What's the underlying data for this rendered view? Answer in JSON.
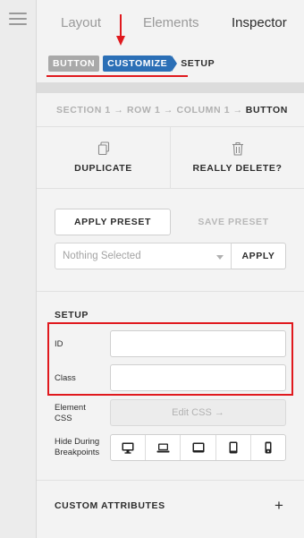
{
  "tabs": [
    "Layout",
    "Elements",
    "Inspector"
  ],
  "breadcrumb": {
    "item1": "BUTTON",
    "item2": "CUSTOMIZE",
    "item3": "SETUP"
  },
  "path": {
    "prefix": "SECTION 1 → ROW 1 → COLUMN 1 →",
    "last": "BUTTON"
  },
  "actions": {
    "duplicate": "DUPLICATE",
    "delete": "REALLY DELETE?"
  },
  "preset": {
    "apply_preset": "APPLY PRESET",
    "save_preset": "SAVE PRESET",
    "select_value": "Nothing Selected",
    "apply": "APPLY"
  },
  "setup": {
    "title": "SETUP",
    "id_label": "ID",
    "id_value": "",
    "class_label": "Class",
    "class_value": "",
    "element_css_label_1": "Element",
    "element_css_label_2": "CSS",
    "edit_css": "Edit CSS →",
    "hide_label_1": "Hide During",
    "hide_label_2": "Breakpoints",
    "breakpoint_icons": [
      "desktop-icon",
      "laptop-icon",
      "tablet-landscape-icon",
      "tablet-portrait-icon",
      "phone-icon"
    ]
  },
  "custom_attributes": {
    "title": "CUSTOM ATTRIBUTES",
    "add": "+"
  },
  "colors": {
    "accent": "#2b6fb6",
    "annotation_red": "#e0191e",
    "muted_badge": "#a9a9a9"
  }
}
